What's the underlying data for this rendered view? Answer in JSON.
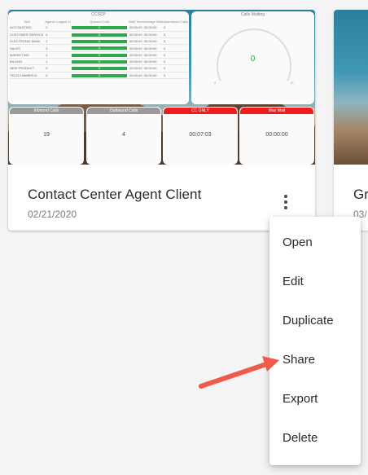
{
  "card": {
    "title": "Contact Center Agent Client",
    "date": "02/21/2020",
    "thumbnail": {
      "table_panel": {
        "title": "CCSCP",
        "headers": [
          "Skill",
          "Agents Logged In",
          "Queued Calls",
          "Wait Time",
          "Average Wait",
          "Abandoned Calls"
        ],
        "rows": [
          [
            "ACCOUNTING",
            "2",
            "0",
            "00:00:00",
            "00:00:00",
            "0"
          ],
          [
            "CUSTOMER SERVICE",
            "4",
            "0",
            "00:00:00",
            "00:00:00",
            "0"
          ],
          [
            "ELECTRONIC BANK",
            "1",
            "0",
            "00:00:00",
            "00:00:00",
            "0"
          ],
          [
            "SALES",
            "3",
            "0",
            "00:00:00",
            "00:00:00",
            "0"
          ],
          [
            "MARKETING",
            "4",
            "0",
            "00:00:00",
            "00:00:00",
            "0"
          ],
          [
            "BILLING",
            "1",
            "0",
            "00:00:00",
            "00:00:00",
            "0"
          ],
          [
            "NEW PRODUCT",
            "0",
            "0",
            "00:00:00",
            "00:00:00",
            "0"
          ],
          [
            "TELECOMMERCE",
            "0",
            "0",
            "00:00:00",
            "00:00:00",
            "0"
          ]
        ]
      },
      "gauge_panel": {
        "title": "Calls Waiting",
        "value": "0",
        "min_label": "0",
        "max_label": "10"
      },
      "stats": [
        {
          "label": "Inbound Calls",
          "value": "19",
          "header_color": "#9a9a9a"
        },
        {
          "label": "Outbound Calls",
          "value": "4",
          "header_color": "#9a9a9a"
        },
        {
          "label": "CC ONLY",
          "value": "00:07:03",
          "header_color": "#ee1d1d"
        },
        {
          "label": "Max Wait",
          "value": "00:00:00",
          "header_color": "#ee1d1d"
        }
      ]
    }
  },
  "card2": {
    "title": "Gr",
    "date": "03/"
  },
  "menu": {
    "items": [
      "Open",
      "Edit",
      "Duplicate",
      "Share",
      "Export",
      "Delete"
    ]
  },
  "annotation": {
    "arrow_color": "#f05a4a",
    "points_to": "Share"
  },
  "icons": {
    "more": "more-vert-icon"
  }
}
